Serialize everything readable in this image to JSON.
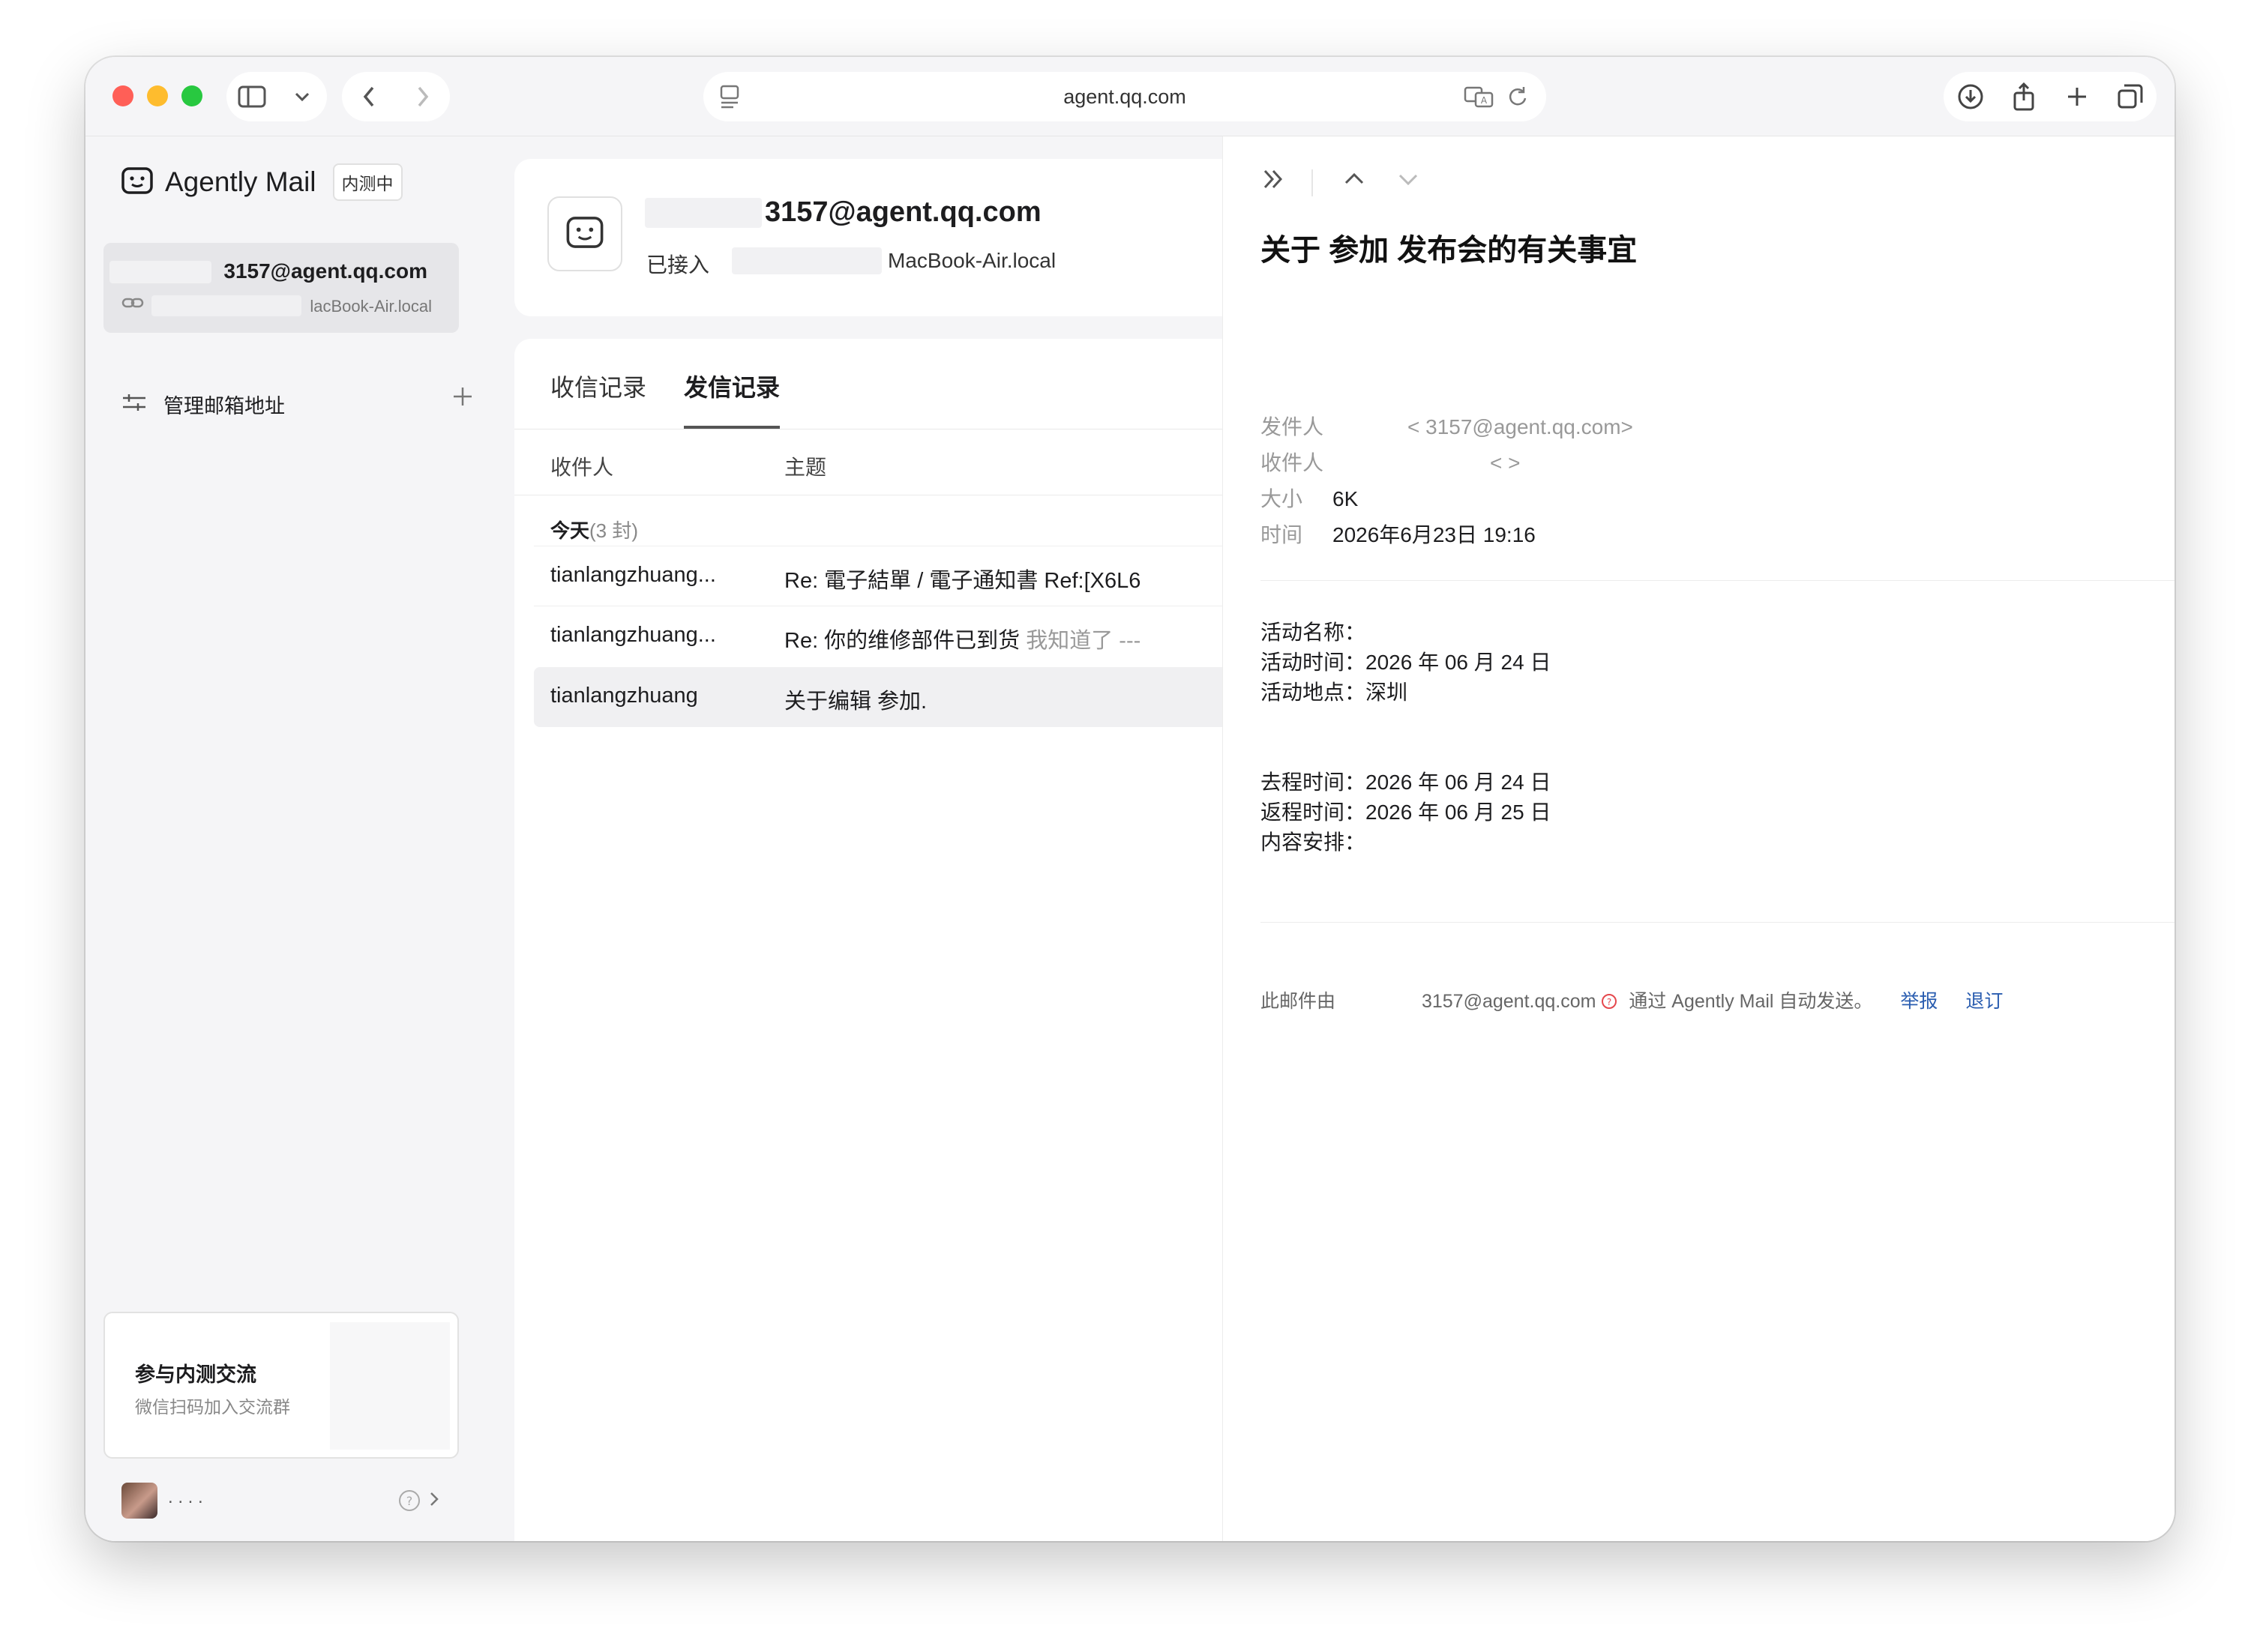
{
  "browser": {
    "address": "agent.qq.com"
  },
  "sidebar": {
    "app_name": "Agently Mail",
    "badge": "内测中",
    "account": {
      "email": "3157@agent.qq.com",
      "host": "lacBook-Air.local"
    },
    "manage_label": "管理邮箱地址",
    "beta_card": {
      "title": "参与内测交流",
      "subtitle": "微信扫码加入交流群"
    },
    "user_name": ". . . ."
  },
  "account_header": {
    "email": "3157@agent.qq.com",
    "connected_label": "已接入",
    "host": "MacBook-Air.local"
  },
  "mail_list": {
    "tabs": [
      {
        "label": "收信记录",
        "active": false
      },
      {
        "label": "发信记录",
        "active": true
      }
    ],
    "columns": [
      "收件人",
      "主题"
    ],
    "group": {
      "label": "今天",
      "count": "(3 封)"
    },
    "rows": [
      {
        "recipient": "tianlangzhuang...",
        "subject": "Re: 電子結單 / 電子通知書 Ref:[X6L6",
        "preview": ""
      },
      {
        "recipient": "tianlangzhuang...",
        "subject": "Re: 你的维修部件已到货",
        "preview": "我知道了 ---"
      },
      {
        "recipient": "tianlangzhuang",
        "subject": "关于编辑      参加.",
        "preview": ""
      }
    ]
  },
  "reader": {
    "title": "关于                参加            发布会的有关事宜",
    "meta": {
      "from_label": "发件人",
      "from_email": "<            3157@agent.qq.com>",
      "to_label": "收件人",
      "to_email": "<                                   >",
      "size_label": "大小",
      "size_value": "6K",
      "time_label": "时间",
      "time_value": "2026年6月23日 19:16"
    },
    "body": {
      "event_name_label": "活动名称：",
      "event_time": "活动时间：2026 年 06 月 24 日",
      "event_location": "活动地点：深圳",
      "depart_time": "去程时间：2026 年 06 月 24 日",
      "return_time": "返程时间：2026 年 06 月 25 日",
      "content_label": "内容安排："
    },
    "footer": {
      "prefix": "此邮件由",
      "sender": "3157@agent.qq.com",
      "suffix": "通过 Agently Mail 自动发送。",
      "report": "举报",
      "unsubscribe": "退订"
    }
  },
  "colors": {
    "link": "#2a5db0",
    "close": "#ff5f57",
    "minimize": "#febc2e",
    "zoom": "#28c840"
  }
}
